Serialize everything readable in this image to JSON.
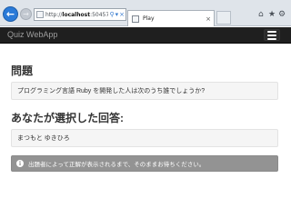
{
  "browser": {
    "url_prefix": "http://",
    "url_host": "localhost",
    "url_rest": ":50457/Pla",
    "tab_title": "Play",
    "back_icon": "back-arrow-icon",
    "forward_icon": "forward-arrow-icon",
    "home_icon": "home-icon",
    "favorites_icon": "star-icon",
    "settings_icon": "gear-icon"
  },
  "navbar": {
    "brand": "Quiz WebApp"
  },
  "question": {
    "heading": "問題",
    "text": "プログラミング言語 Ruby を開発した人は次のうち誰でしょうか?"
  },
  "answer": {
    "heading": "あなたが選択した回答:",
    "text": "まつもと ゆきひろ"
  },
  "alert": {
    "text": "出題者によって正解が表示されるまで、そのままお待ちください。"
  },
  "colors": {
    "navbar_bg": "#1f1f1f",
    "alert_bg": "#939393",
    "well_bg": "#f5f5f5",
    "browser_accent": "#2a7ad8"
  }
}
